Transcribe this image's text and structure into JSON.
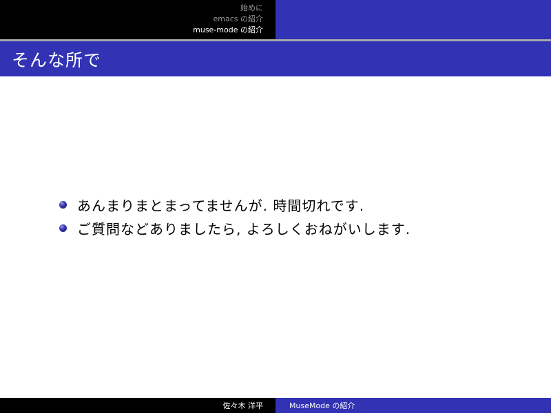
{
  "header": {
    "nav_items": [
      {
        "label": "始めに",
        "current": false
      },
      {
        "label": "emacs の紹介",
        "current": false
      },
      {
        "label": "muse-mode の紹介",
        "current": true
      }
    ]
  },
  "frame": {
    "title": "そんな所で",
    "bullets": [
      "あんまりまとまってませんが. 時間切れです.",
      "ご質問などありましたら, よろしくおねがいします."
    ]
  },
  "footer": {
    "author": "佐々木 洋平",
    "short_title": "MuseMode の紹介"
  },
  "colors": {
    "theme_blue": "#3232b4",
    "black": "#000000",
    "nav_inactive": "#9a9a9a"
  }
}
